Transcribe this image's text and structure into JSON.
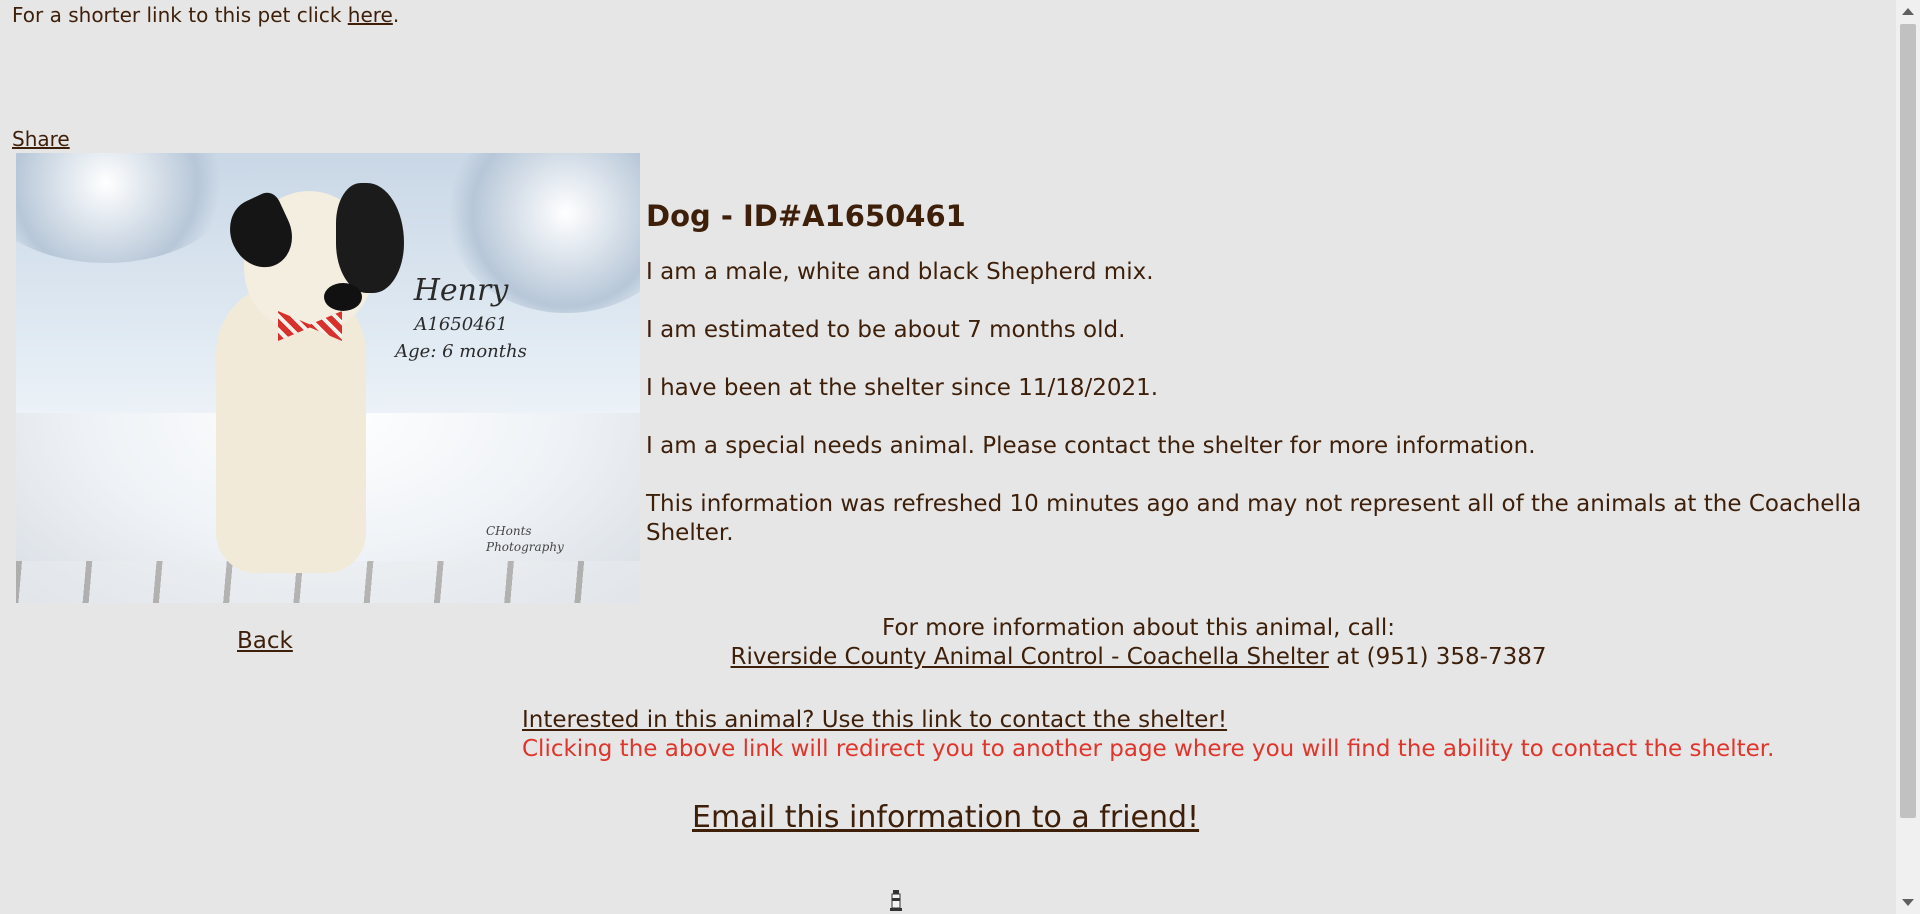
{
  "top": {
    "shorter_link_prefix": "For a shorter link to this pet click ",
    "shorter_link_label": "here",
    "shorter_link_suffix": "."
  },
  "share_label": "Share",
  "photo": {
    "name": "Henry",
    "id": "A1650461",
    "age": "Age: 6 months",
    "credit_line1": "CHonts",
    "credit_line2": "Photography"
  },
  "animal": {
    "heading": "Dog - ID#A1650461",
    "line1": "I am a male, white and black Shepherd mix.",
    "line2": "I am estimated to be about 7 months old.",
    "line3": "I have been at the shelter since 11/18/2021.",
    "line4": "I am a special needs animal. Please contact the shelter for more information.",
    "line5": "This information was refreshed 10 minutes ago and may not represent all of the animals at the Coachella Shelter."
  },
  "back_label": "Back",
  "contact": {
    "prompt": "For more information about this animal, call:",
    "shelter_link": "Riverside County Animal Control - Coachella Shelter",
    "phone_text": " at (951) 358-7387"
  },
  "interest": {
    "link_label": "Interested in this animal? Use this link to contact the shelter!",
    "redirect_note": "Clicking the above link will redirect you to another page where you will find the ability to contact the shelter."
  },
  "email_label": "Email this information to a friend!",
  "colors": {
    "background": "#e6e6e6",
    "text": "#3d1f0a",
    "warning": "#e0352b"
  }
}
